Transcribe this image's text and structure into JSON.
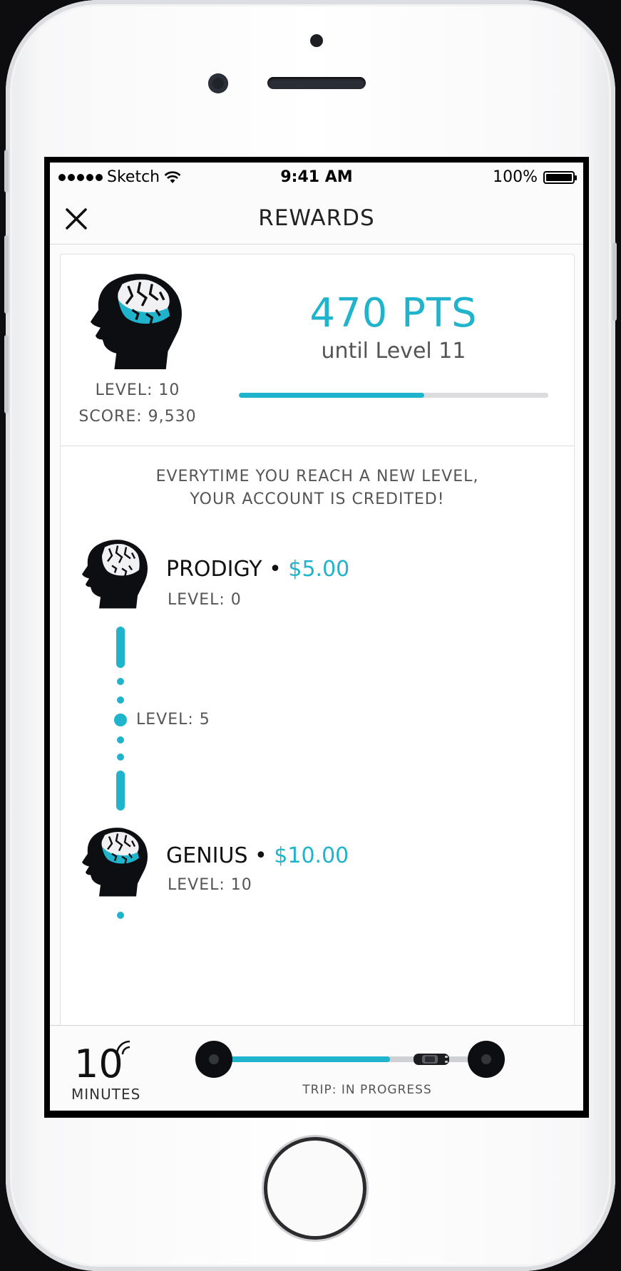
{
  "status_bar": {
    "carrier": "Sketch",
    "time": "9:41 AM",
    "battery": "100%"
  },
  "nav": {
    "title": "REWARDS"
  },
  "summary": {
    "level_text": "LEVEL: 10",
    "score_text": "SCORE: 9,530",
    "points": "470 PTS",
    "until_text": "until Level 11",
    "progress_fraction": 0.6
  },
  "credit_message": {
    "line1": "EVERYTIME YOU REACH A NEW LEVEL,",
    "line2": "YOUR ACCOUNT IS CREDITED!"
  },
  "tiers": [
    {
      "name": "PRODIGY",
      "separator": " • ",
      "amount": "$5.00",
      "level": "LEVEL: 0"
    },
    {
      "name": "GENIUS",
      "separator": " • ",
      "amount": "$10.00",
      "level": "LEVEL: 10"
    }
  ],
  "timeline": {
    "mid_level": "LEVEL: 5"
  },
  "trip": {
    "eta_value": "10",
    "eta_unit": "MINUTES",
    "status": "TRIP: IN PROGRESS",
    "progress_fraction": 0.65
  },
  "colors": {
    "accent": "#1fb3cc",
    "text_dark": "#111111",
    "text_muted": "#555555"
  },
  "icons": {
    "close": "close-icon",
    "brain_head": "brain-head-icon",
    "wifi": "wifi-icon",
    "signal": "live-signal-icon",
    "car": "car-icon"
  }
}
